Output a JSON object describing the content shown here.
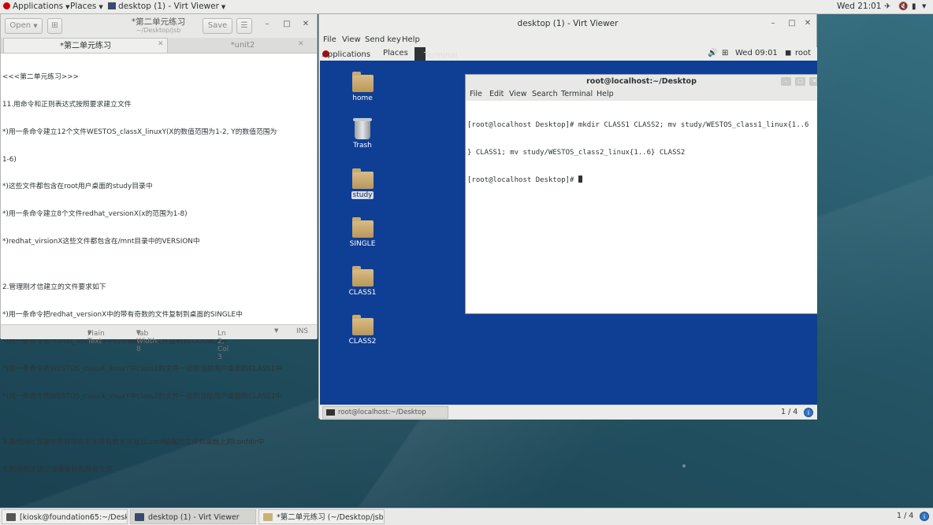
{
  "host_topbar": {
    "applications": "Applications",
    "places": "Places",
    "window": "desktop (1) - Virt Viewer",
    "clock": "Wed 21:01"
  },
  "editor": {
    "open_label": "Open",
    "save_label": "Save",
    "title": "*第二单元练习",
    "subtitle": "~/Desktop/jsb",
    "tabs": [
      {
        "label": "*第二单元练习"
      },
      {
        "label": "*unit2"
      }
    ],
    "lines": [
      "<<<第二单元练习>>>",
      "11.用命令和正则表达式按照要求建立文件",
      "*)用一条命令建立12个文件WESTOS_classX_linuxY(X的数值范围为1-2, Y的数值范围为",
      "1-6)",
      "*)这些文件都包含在root用户桌面的study目录中",
      "*)用一条命令建立8个文件redhat_versionX(x的范围为1-8)",
      "*)redhat_virsionX这些文件都包含在/mnt目录中的VERSION中",
      "",
      "2.管理刚才信建立的文件要求如下",
      "*)用一条命令把redhat_versionX中的带有奇数的文件复制到桌面的SINGLE中",
      "*)用一条命令把redhat_versionX中的带偶数数的文件复制到/DOUBLE中",
      "*)用一条命令把WESTOS_classX_linuxY中class1的文件一动到当前用户桌面的CLASS1中",
      "*)用一条命令把WESTOS_classX_linuxY中class2的文件一动到当前用户桌面的CLASS2中",
      "",
      "3.备份/etc目录中所有带有名字带有数字并且以.conf结尾的文件到桌面上的confdir中",
      "5.删掉刚才建立或者备份的所有文件"
    ],
    "status": {
      "lang": "Plain Text",
      "tab_width": "Tab Width: 8",
      "position": "Ln 2, Col 3",
      "mode": "INS"
    }
  },
  "virt_viewer": {
    "title": "desktop (1) - Virt Viewer",
    "menu": [
      "File",
      "View",
      "Send key",
      "Help"
    ],
    "guest_topbar": {
      "applications": "Applications",
      "places": "Places",
      "terminal": "Terminal",
      "clock": "Wed 09:01",
      "user": "root"
    },
    "desktop_icons": [
      {
        "label": "home"
      },
      {
        "label": "Trash"
      },
      {
        "label": "study"
      },
      {
        "label": "SINGLE"
      },
      {
        "label": "CLASS1"
      },
      {
        "label": "CLASS2"
      }
    ],
    "terminal": {
      "title": "root@localhost:~/Desktop",
      "menu": [
        "File",
        "Edit",
        "View",
        "Search",
        "Terminal",
        "Help"
      ],
      "lines": [
        "[root@localhost Desktop]# mkdir CLASS1 CLASS2; mv study/WESTOS_class1_linux{1..6",
        "} CLASS1; mv study/WESTOS_class2_linux{1..6} CLASS2",
        "[root@localhost Desktop]# "
      ]
    },
    "guest_task": "root@localhost:~/Desktop",
    "workspace": "1 / 4"
  },
  "host_taskbar": {
    "tasks": [
      {
        "label": "[kiosk@foundation65:~/Desktop]"
      },
      {
        "label": "desktop (1) - Virt Viewer"
      },
      {
        "label": "*第二单元练习 (~/Desktop/jsb) - ..."
      }
    ],
    "workspace": "1 / 4"
  }
}
